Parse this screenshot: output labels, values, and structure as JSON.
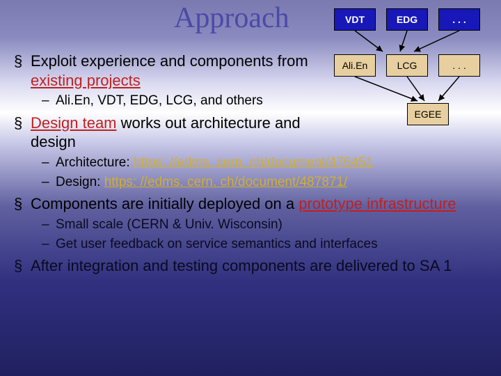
{
  "title": "Approach",
  "bullets": {
    "b1": {
      "pre": "Exploit experience and components from ",
      "red": "existing projects"
    },
    "b1s1": "Ali.En, VDT, EDG, LCG, and others",
    "b2": {
      "red": "Design team",
      "post": " works out architecture and design"
    },
    "b2s1": {
      "pre": "Architecture: ",
      "link": "https: //edms. cern. ch/document/476451"
    },
    "b2s2": {
      "pre": "Design: ",
      "link": "https: //edms. cern. ch/document/487871/"
    },
    "b3": {
      "pre": "Components are initially deployed on a ",
      "red": "prototype infrastructure"
    },
    "b3s1": "Small scale (CERN & Univ. Wisconsin)",
    "b3s2": "Get user feedback on service semantics and interfaces",
    "b4": "After integration and testing components are delivered to SA 1"
  },
  "diagram": {
    "row1": {
      "a": "VDT",
      "b": "EDG",
      "c": ". . ."
    },
    "row2": {
      "a": "Ali.En",
      "b": "LCG",
      "c": ". . ."
    },
    "row3": {
      "a": "EGEE"
    }
  }
}
